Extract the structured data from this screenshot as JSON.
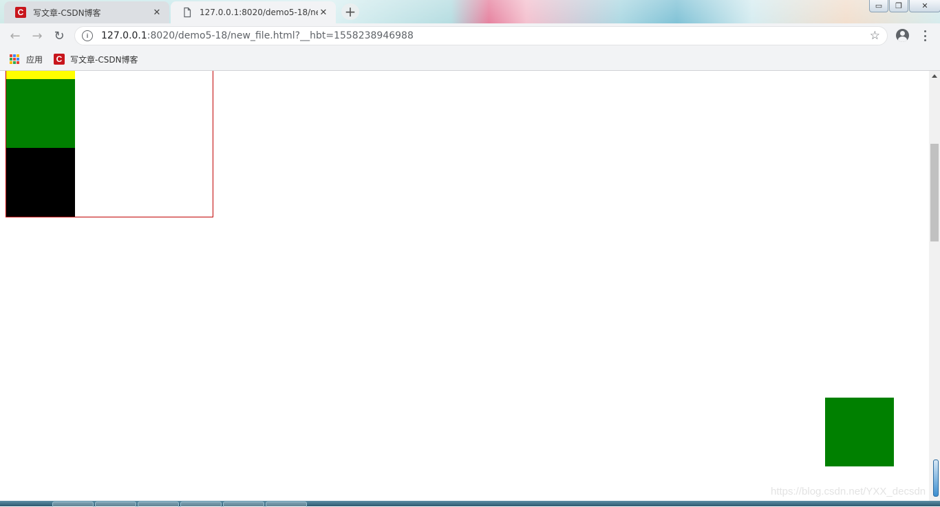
{
  "browser": {
    "tabs": [
      {
        "title": "写文章-CSDN博客",
        "favicon": "csdn-logo",
        "favicon_letter": "C",
        "close_glyph": "✕",
        "active": false
      },
      {
        "title": "127.0.0.1:8020/demo5-18/new_file.html?__hbt=1558238946988",
        "favicon": "page-icon",
        "close_glyph": "✕",
        "active": true
      }
    ],
    "new_tab_glyph": "+",
    "window_controls": {
      "minimize": "▭",
      "restore": "❐",
      "close": "✕"
    }
  },
  "toolbar": {
    "back_glyph": "←",
    "forward_glyph": "→",
    "reload_glyph": "↻",
    "info_glyph": "i",
    "url_host": "127.0.0.1",
    "url_rest": ":8020/demo5-18/new_file.html?__hbt=1558238946988",
    "star_glyph": "☆"
  },
  "bookmarks": [
    {
      "label": "应用",
      "icon": "apps-grid-icon"
    },
    {
      "label": "写文章-CSDN博客",
      "icon": "csdn-logo",
      "icon_letter": "C"
    }
  ],
  "page": {
    "colors": {
      "border": "#c00000",
      "yellow": "#ffff00",
      "green": "#008000",
      "black": "#000000"
    },
    "watermark": "https://blog.csdn.net/YXX_decsdn"
  }
}
